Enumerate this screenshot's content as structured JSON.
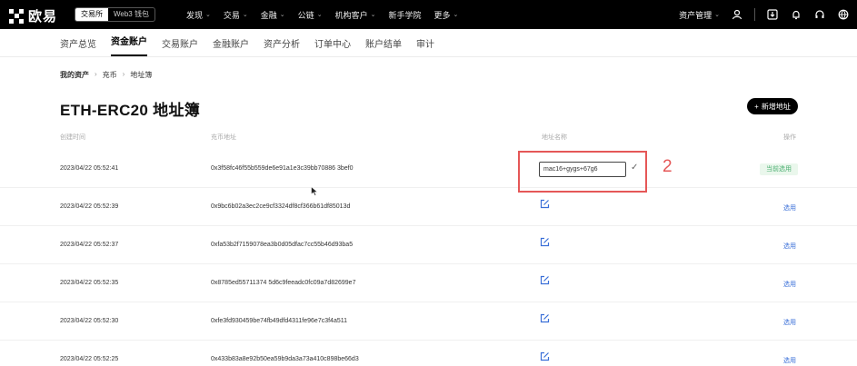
{
  "topbar": {
    "brand": "欧易",
    "mode_exchange": "交易所",
    "mode_web3": "Web3 钱包",
    "nav": [
      "发现",
      "交易",
      "金融",
      "公链",
      "机构客户",
      "新手学院",
      "更多"
    ],
    "asset_management": "资产管理"
  },
  "subnav": [
    "资产总览",
    "资金账户",
    "交易账户",
    "金融账户",
    "资产分析",
    "订单中心",
    "账户结单",
    "审计"
  ],
  "breadcrumb": [
    "我的资产",
    "充币",
    "地址簿"
  ],
  "page_title": "ETH-ERC20 地址簿",
  "add_button": "新增地址",
  "table": {
    "headers": {
      "time": "创建时间",
      "address": "充币地址",
      "name": "地址名称",
      "action": "操作"
    },
    "rows": [
      {
        "time": "2023/04/22 05:52:41",
        "address": "0x3f58fc46f55b559de6e91a1e3c39bb70886 3bef0",
        "action": "当前选用"
      },
      {
        "time": "2023/04/22 05:52:39",
        "address": "0x9bc6b02a3ec2ce9cf3324df8cf366b61df85013d",
        "action": "选用"
      },
      {
        "time": "2023/04/22 05:52:37",
        "address": "0xfa53b2f7159078ea3b0d05dfac7cc55b46d93ba5",
        "action": "选用"
      },
      {
        "time": "2023/04/22 05:52:35",
        "address": "0x8785ed55711374 5d6c9feeadc0fc09a7d82699e7",
        "action": "选用"
      },
      {
        "time": "2023/04/22 05:52:30",
        "address": "0xfe3fd930459be74fb49dfd4311fe96e7c3f4a511",
        "action": "选用"
      },
      {
        "time": "2023/04/22 05:52:25",
        "address": "0x433b83a8e92b50ea59b9da3a73a410c898be66d3",
        "action": "选用"
      }
    ]
  },
  "editing_name_value": "mac16+gygs+67g6",
  "annotation_step": "2",
  "colors": {
    "highlight": "#e55757",
    "link": "#3a6fd8",
    "badge_bg": "#eaf7ec",
    "badge_fg": "#4caf72"
  }
}
